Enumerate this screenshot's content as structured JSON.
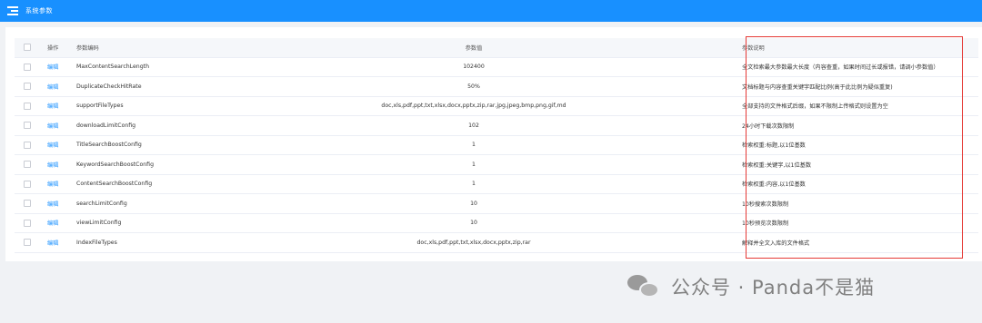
{
  "header": {
    "title": "系统参数",
    "menu_icon": "menu-fold-icon",
    "bg_color": "#1890ff"
  },
  "table": {
    "columns": {
      "select": "",
      "operation": "操作",
      "code": "参数编码",
      "value": "参数值",
      "description": "参数说明"
    },
    "rows": [
      {
        "action": "编辑",
        "code": "MaxContentSearchLength",
        "value": "102400",
        "description": "全文检索最大参数最大长度（内容查重，如果时间过长或报错，请调小参数值）"
      },
      {
        "action": "编辑",
        "code": "DuplicateCheckHitRate",
        "value": "50%",
        "description": "文档标题与内容查重关键字匹配比例(高于此比例为疑似重复)"
      },
      {
        "action": "编辑",
        "code": "supportFileTypes",
        "value": "doc,xls,pdf,ppt,txt,xlsx,docx,pptx,zip,rar,jpg,jpeg,bmp,png,gif,md",
        "description": "全部支持的文件格式后缀，如果不限制上传格式则设置为空"
      },
      {
        "action": "编辑",
        "code": "downloadLimitConfig",
        "value": "102",
        "description": "24小时下载次数限制"
      },
      {
        "action": "编辑",
        "code": "TitleSearchBoostConfig",
        "value": "1",
        "description": "检索权重:标题,以1位基数"
      },
      {
        "action": "编辑",
        "code": "KeywordSearchBoostConfig",
        "value": "1",
        "description": "检索权重:关键字,以1位基数"
      },
      {
        "action": "编辑",
        "code": "ContentSearchBoostConfig",
        "value": "1",
        "description": "检索权重:内容,以1位基数"
      },
      {
        "action": "编辑",
        "code": "searchLimitConfig",
        "value": "10",
        "description": "10秒搜索次数限制"
      },
      {
        "action": "编辑",
        "code": "viewLimitConfig",
        "value": "10",
        "description": "10秒预览次数限制"
      },
      {
        "action": "编辑",
        "code": "IndexFileTypes",
        "value": "doc,xls,pdf,ppt,txt,xlsx,docx,pptx,zip,rar",
        "description": "解释并全文入库的文件格式"
      }
    ]
  },
  "highlight": {
    "color": "#e53935"
  },
  "watermark": {
    "text": "公众号 · Panda不是猫",
    "icon": "wechat-icon"
  }
}
